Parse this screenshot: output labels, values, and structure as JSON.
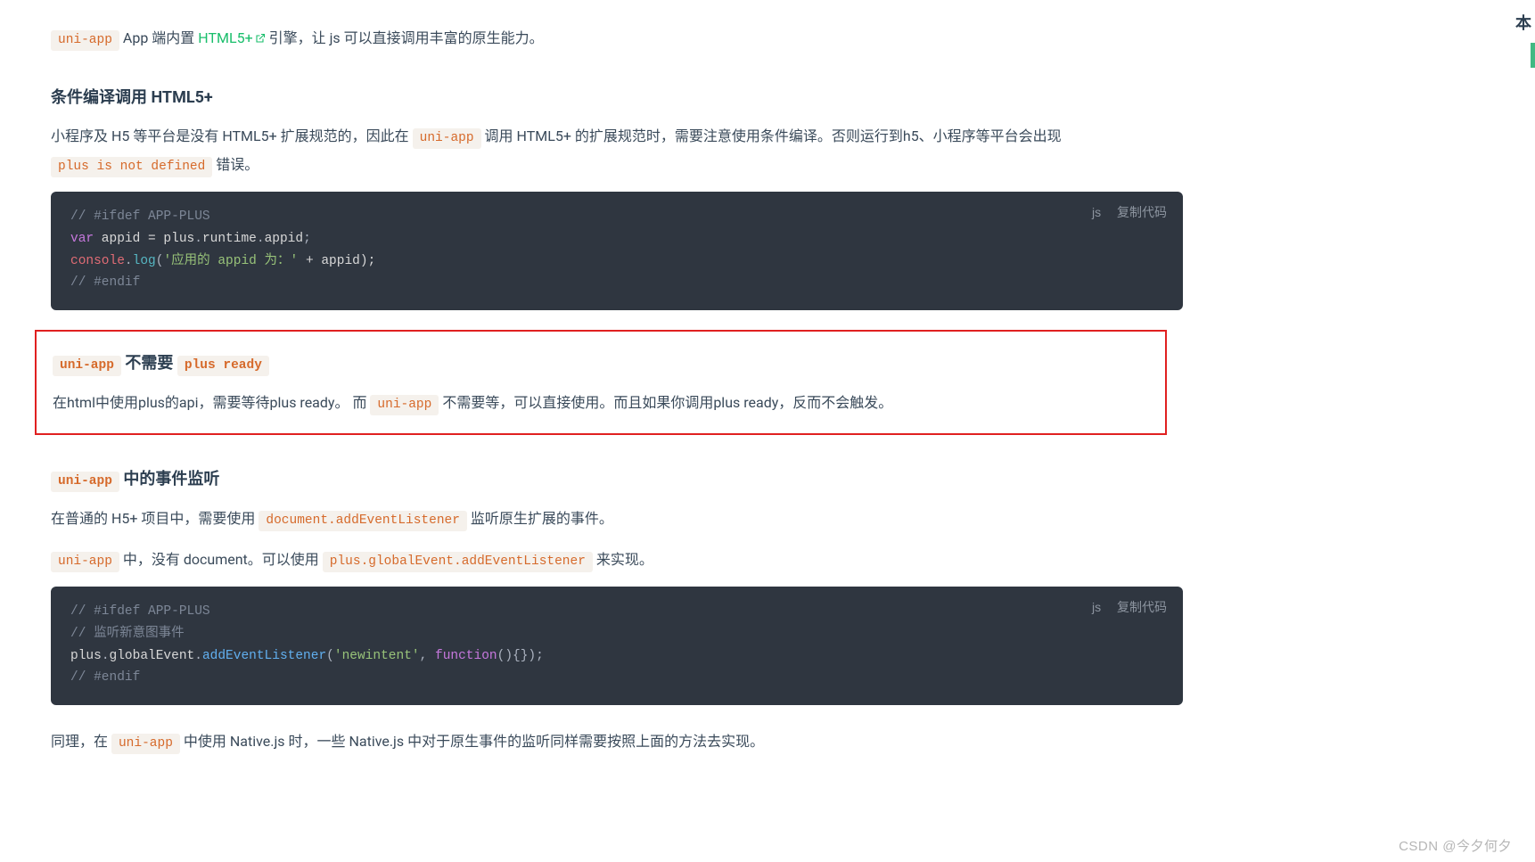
{
  "intro": {
    "code1": "uni-app",
    "txt1": " App 端内置 ",
    "link_text": "HTML5+",
    "txt2": " 引擎，让 js 可以直接调用丰富的原生能力。"
  },
  "section1": {
    "heading": "条件编译调用 HTML5+",
    "p_a": "小程序及 H5 等平台是没有 HTML5+ 扩展规范的，因此在 ",
    "p_code1": "uni-app",
    "p_b": " 调用 HTML5+ 的扩展规范时，需要注意使用条件编译。否则运行到h5、小程序等平台会出现 ",
    "p_code2": "plus is not defined",
    "p_c": " 错误。"
  },
  "codeblock1": {
    "lang": "js",
    "copy": "复制代码",
    "l1": "// #ifdef APP-PLUS",
    "l2_kw": "var",
    "l2_id": " appid = plus",
    "l2_dot1": ".",
    "l2_prop1": "runtime",
    "l2_dot2": ".",
    "l2_prop2": "appid",
    "l2_end": ";",
    "l3_obj": "console",
    "l3_dot": ".",
    "l3_fn": "log",
    "l3_p1": "(",
    "l3_str": "'应用的 appid 为：'",
    "l3_plus": " + appid);",
    "l4": "// #endif"
  },
  "section2": {
    "h_code1": "uni-app",
    "h_txt": " 不需要 ",
    "h_code2": "plus ready",
    "p_a": "在html中使用plus的api，需要等待plus ready。 而 ",
    "p_code": "uni-app",
    "p_b": " 不需要等，可以直接使用。而且如果你调用plus ready，反而不会触发。"
  },
  "section3": {
    "h_code": "uni-app",
    "h_txt": " 中的事件监听",
    "p1_a": "在普通的 H5+ 项目中，需要使用 ",
    "p1_code": "document.addEventListener",
    "p1_b": " 监听原生扩展的事件。",
    "p2_code1": "uni-app",
    "p2_a": " 中，没有 document。可以使用 ",
    "p2_code2": "plus.globalEvent.addEventListener",
    "p2_b": " 来实现。"
  },
  "codeblock2": {
    "lang": "js",
    "copy": "复制代码",
    "l1": "// #ifdef APP-PLUS",
    "l2": "// 监听新意图事件",
    "l3_a": "plus",
    "l3_b": ".",
    "l3_c": "globalEvent",
    "l3_d": ".",
    "l3_fn": "addEventListener",
    "l3_p1": "(",
    "l3_str": "'newintent'",
    "l3_comma": ", ",
    "l3_kw": "function",
    "l3_rest": "(){});",
    "l4": "// #endif"
  },
  "section4": {
    "p_a": "同理，在 ",
    "p_code": "uni-app",
    "p_b": " 中使用 Native.js 时，一些 Native.js 中对于原生事件的监听同样需要按照上面的方法去实现。"
  },
  "edge": {
    "char": "本",
    "watermark": "CSDN @今夕何夕"
  }
}
